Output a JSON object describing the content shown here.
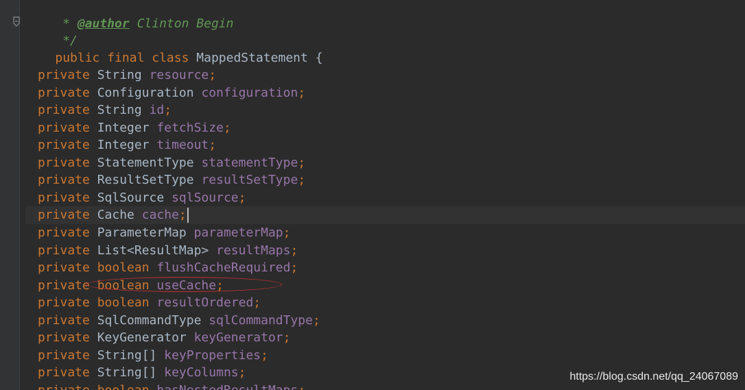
{
  "editor": {
    "header_comment": [
      {
        "prefix": " * ",
        "tag": "@author",
        "text": " Clinton Begin"
      },
      {
        "prefix": " */",
        "tag": "",
        "text": ""
      }
    ],
    "class_declaration": {
      "modifiers": "public final class",
      "name": "MappedStatement",
      "brace": "{"
    },
    "fields": [
      {
        "modifier": "private",
        "type": "String",
        "name": "resource"
      },
      {
        "modifier": "private",
        "type": "Configuration",
        "name": "configuration"
      },
      {
        "modifier": "private",
        "type": "String",
        "name": "id"
      },
      {
        "modifier": "private",
        "type": "Integer",
        "name": "fetchSize"
      },
      {
        "modifier": "private",
        "type": "Integer",
        "name": "timeout"
      },
      {
        "modifier": "private",
        "type": "StatementType",
        "name": "statementType"
      },
      {
        "modifier": "private",
        "type": "ResultSetType",
        "name": "resultSetType"
      },
      {
        "modifier": "private",
        "type": "SqlSource",
        "name": "sqlSource"
      },
      {
        "modifier": "private",
        "type": "Cache",
        "name": "cache",
        "current": true
      },
      {
        "modifier": "private",
        "type": "ParameterMap",
        "name": "parameterMap"
      },
      {
        "modifier": "private",
        "type": "List<ResultMap>",
        "name": "resultMaps"
      },
      {
        "modifier": "private",
        "type": "boolean",
        "type_keyword": true,
        "name": "flushCacheRequired"
      },
      {
        "modifier": "private",
        "type": "boolean",
        "type_keyword": true,
        "name": "useCache",
        "highlighted": true
      },
      {
        "modifier": "private",
        "type": "boolean",
        "type_keyword": true,
        "name": "resultOrdered"
      },
      {
        "modifier": "private",
        "type": "SqlCommandType",
        "name": "sqlCommandType"
      },
      {
        "modifier": "private",
        "type": "KeyGenerator",
        "name": "keyGenerator"
      },
      {
        "modifier": "private",
        "type": "String[]",
        "name": "keyProperties"
      },
      {
        "modifier": "private",
        "type": "String[]",
        "name": "keyColumns"
      },
      {
        "modifier": "private",
        "type": "boolean",
        "type_keyword": true,
        "name": "hasNestedResultMaps"
      }
    ],
    "semicolon": ";"
  },
  "watermark": "https://blog.csdn.net/qq_24067089",
  "colors": {
    "background": "#2b2b2b",
    "keyword": "#cc7832",
    "field": "#9876aa",
    "text": "#a9b7c6",
    "comment": "#629755",
    "annotation_circle": "#c53030"
  },
  "icons": {
    "fold_marker": "fold-marker-icon"
  }
}
